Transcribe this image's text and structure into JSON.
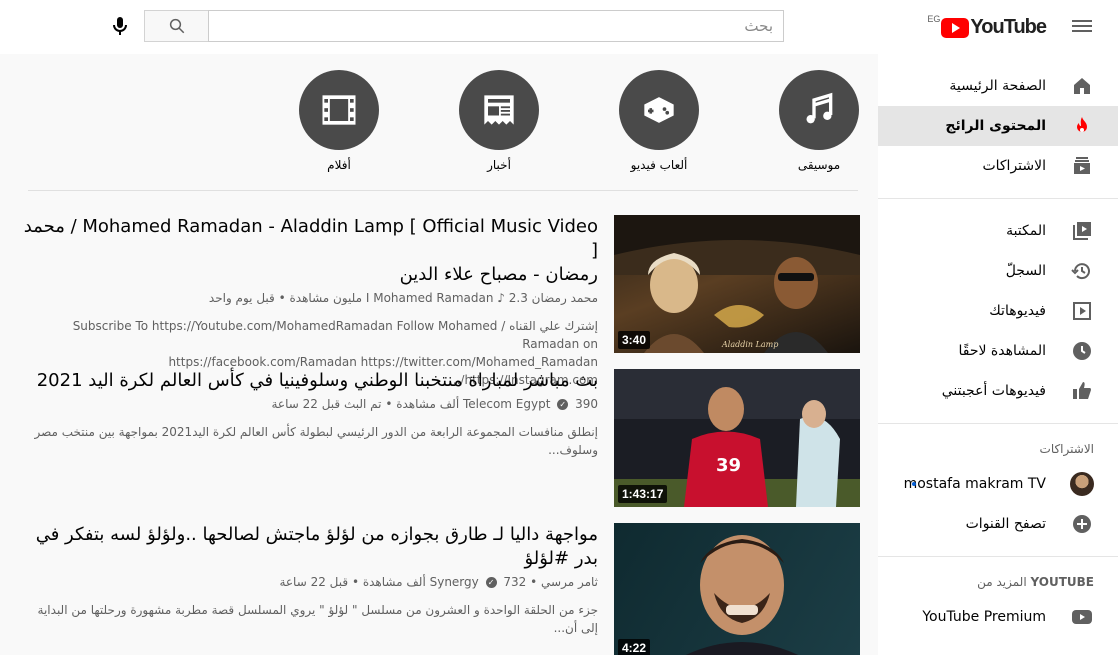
{
  "header": {
    "logo_text": "YouTube",
    "region": "EG",
    "search_placeholder": "بحث"
  },
  "sidebar": {
    "main": [
      {
        "label": "الصفحة الرئيسية",
        "icon": "home-icon"
      },
      {
        "label": "المحتوى الرائج",
        "icon": "fire-icon",
        "active": true
      },
      {
        "label": "الاشتراكات",
        "icon": "subscriptions-icon"
      }
    ],
    "library": [
      {
        "label": "المكتبة",
        "icon": "library-icon"
      },
      {
        "label": "السجلّ",
        "icon": "history-icon"
      },
      {
        "label": "فيديوهاتك",
        "icon": "your-videos-icon"
      },
      {
        "label": "المشاهدة لاحقًا",
        "icon": "watch-later-icon"
      },
      {
        "label": "فيديوهات أعجبتني",
        "icon": "like-icon"
      }
    ],
    "subs_heading": "الاشتراكات",
    "subs": [
      {
        "label": "mostafa makram TV",
        "icon": "avatar"
      },
      {
        "label": "تصفح القنوات",
        "icon": "add-circle-icon"
      }
    ],
    "more_heading_prefix": "المزيد من",
    "more_heading_brand": "YOUTUBE",
    "more": [
      {
        "label": "YouTube Premium",
        "icon": "youtube-icon"
      }
    ]
  },
  "categories": [
    {
      "label": "موسيقى",
      "icon": "music-note-icon"
    },
    {
      "label": "ألعاب فيديو",
      "icon": "gamepad-icon"
    },
    {
      "label": "أخبار",
      "icon": "newspaper-icon"
    },
    {
      "label": "أفلام",
      "icon": "film-icon"
    }
  ],
  "videos": [
    {
      "title": "محمد رمضان - مصباح علاء الدين / Mohamed Ramadan - Aladdin Lamp [ Official Music Video ]",
      "title_line1": "محمد  /  Mohamed Ramadan - Aladdin Lamp [ Official Music Video ]",
      "title_line2": "رمضان - مصباح علاء الدين",
      "channel": "محمد رمضان I Mohamed Ramadan",
      "views": "2.3 مليون مشاهدة",
      "age": "قبل يوم واحد",
      "desc_line1": "إشترك علي القناه / Subscribe To https://Youtube.com/MohamedRamadan Follow Mohamed Ramadan on",
      "desc_line2": "https://facebook.com/Ramadan https://twitter.com/Mohamed_Ramadan https://Instagram.com/...",
      "duration": "3:40",
      "thumb_colors": [
        "#3a2a1a",
        "#c9a36b",
        "#e8d3a8"
      ]
    },
    {
      "title": "بث مباشر لمباراة منتخبنا الوطني وسلوفينيا في كأس العالم لكرة اليد 2021",
      "channel": "Telecom Egypt",
      "views": "390 ألف مشاهدة",
      "age": "تم البث قبل 22 ساعة",
      "desc_line1": "إنطلق منافسات المجموعة الرابعة من الدور الرئيسي لبطولة كأس العالم لكرة اليد2021 بمواجهة بين منتخب مصر وسلوف...",
      "duration": "1:43:17",
      "thumb_colors": [
        "#1b1d24",
        "#c8102e",
        "#5a6e3a"
      ]
    },
    {
      "title": "مواجهة داليا لـ طارق بجوازه من لؤلؤ ماجتش لصالحها ..ولؤلؤ لسه بتفكر في بدر #لؤلؤ",
      "channel_prefix": "ثامر مرسي",
      "channel": "Synergy",
      "views": "732 ألف مشاهدة",
      "age": "قبل 22 ساعة",
      "desc_line1": "جزء من الحلقة الواحدة و العشرون من مسلسل \" لؤلؤ \" يروي المسلسل قصة مطربة مشهورة ورحلتها من البداية إلى أن...",
      "duration": "4:22",
      "thumb_colors": [
        "#0f2a30",
        "#b38a6a",
        "#e0b890"
      ]
    }
  ]
}
